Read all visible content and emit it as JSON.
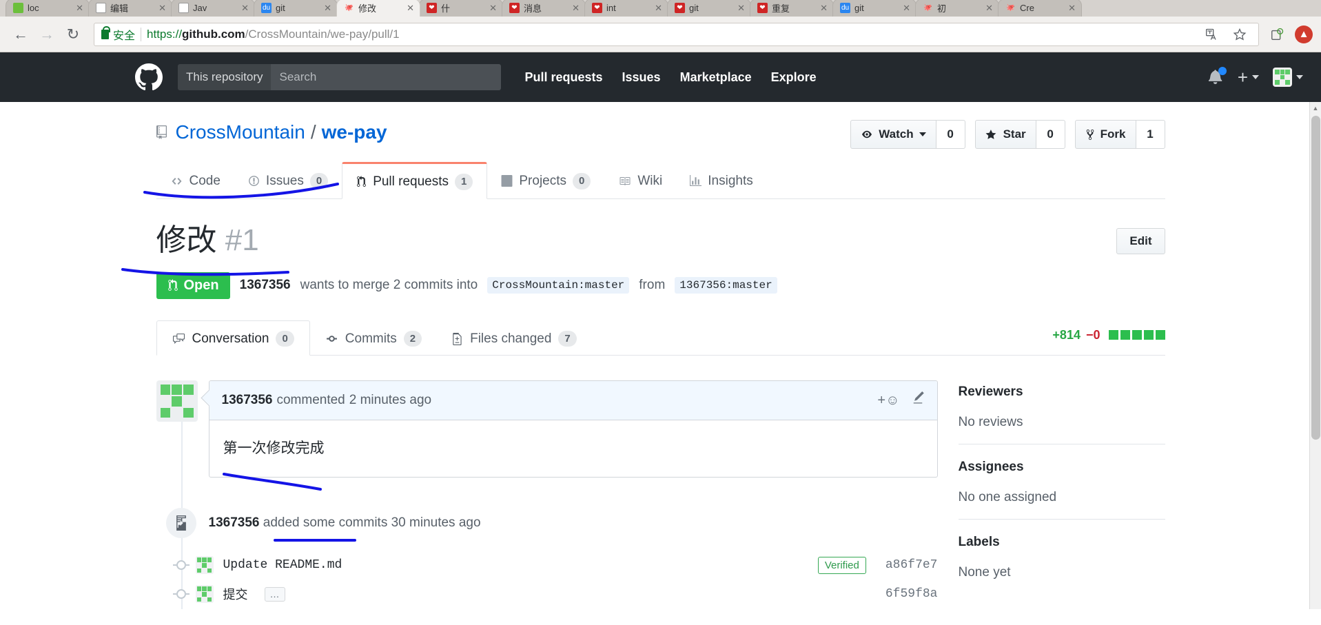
{
  "browser": {
    "tabs": [
      {
        "title": "loc",
        "icon": "leaf-favicon",
        "active": false
      },
      {
        "title": "编辑",
        "icon": "doc-favicon",
        "active": false
      },
      {
        "title": "Jav",
        "icon": "page-favicon",
        "active": false
      },
      {
        "title": "git",
        "icon": "baidu-favicon",
        "active": false
      },
      {
        "title": "修改",
        "icon": "github-favicon",
        "active": true
      },
      {
        "title": "什",
        "icon": "red-favicon",
        "active": false
      },
      {
        "title": "消息",
        "icon": "red-favicon",
        "active": false
      },
      {
        "title": "int",
        "icon": "red-favicon",
        "active": false
      },
      {
        "title": "git",
        "icon": "red-favicon",
        "active": false
      },
      {
        "title": "重复",
        "icon": "red-favicon",
        "active": false
      },
      {
        "title": "git",
        "icon": "baidu-favicon",
        "active": false
      },
      {
        "title": "初",
        "icon": "github-favicon",
        "active": false
      },
      {
        "title": "Cre",
        "icon": "github-favicon",
        "active": false
      }
    ],
    "back_icon": "back-arrow-icon",
    "forward_icon": "forward-arrow-icon",
    "reload_icon": "reload-icon",
    "secure_label": "安全",
    "url": {
      "scheme": "https://",
      "host": "github.com",
      "path": "/CrossMountain/we-pay/pull/1"
    },
    "translate_icon": "translate-icon",
    "bookmark_icon": "star-icon",
    "extension_icon": "extension-icon",
    "profile_icon": "profile-avatar-icon"
  },
  "gh_header": {
    "logo": "github-mark-icon",
    "search_scope": "This repository",
    "search_placeholder": "Search",
    "nav": [
      "Pull requests",
      "Issues",
      "Marketplace",
      "Explore"
    ],
    "notification_icon": "bell-icon",
    "create_new_icon": "plus-icon",
    "account_icon": "user-avatar-icon"
  },
  "repo": {
    "book_icon": "repo-book-icon",
    "owner": "CrossMountain",
    "separator": "/",
    "name": "we-pay",
    "actions": [
      {
        "label": "Watch",
        "count": "0",
        "icon": "eye-icon",
        "has_caret": true
      },
      {
        "label": "Star",
        "count": "0",
        "icon": "star-icon",
        "has_caret": false
      },
      {
        "label": "Fork",
        "count": "1",
        "icon": "fork-icon",
        "has_caret": false
      }
    ],
    "tabs": [
      {
        "label": "Code",
        "count": null,
        "icon": "code-icon",
        "selected": false
      },
      {
        "label": "Issues",
        "count": "0",
        "icon": "issue-opened-icon",
        "selected": false
      },
      {
        "label": "Pull requests",
        "count": "1",
        "icon": "git-pull-request-icon",
        "selected": true
      },
      {
        "label": "Projects",
        "count": "0",
        "icon": "project-board-icon",
        "selected": false
      },
      {
        "label": "Wiki",
        "count": null,
        "icon": "book-icon",
        "selected": false
      },
      {
        "label": "Insights",
        "count": null,
        "icon": "graph-icon",
        "selected": false
      }
    ]
  },
  "pull_request": {
    "title": "修改",
    "number": "#1",
    "edit_label": "Edit",
    "state": "Open",
    "state_icon": "git-pull-request-icon",
    "author": "1367356",
    "merge_text": "wants to merge 2 commits into",
    "base_branch": "CrossMountain:master",
    "from_text": "from",
    "head_branch": "1367356:master",
    "tabs": [
      {
        "label": "Conversation",
        "count": "0",
        "icon": "comment-discussion-icon",
        "selected": true
      },
      {
        "label": "Commits",
        "count": "2",
        "icon": "git-commit-icon",
        "selected": false
      },
      {
        "label": "Files changed",
        "count": "7",
        "icon": "diff-file-icon",
        "selected": false
      }
    ],
    "diffstat": {
      "additions": "+814",
      "deletions": "−0",
      "blocks": 5
    }
  },
  "comment": {
    "author": "1367356",
    "action": "commented",
    "time": "2 minutes ago",
    "body": "第一次修改完成",
    "reaction_icon": "add-reaction-icon",
    "edit_icon": "pencil-icon",
    "avatar_icon": "user-avatar-icon"
  },
  "timeline": {
    "event_icon": "commit-push-icon",
    "event_author": "1367356",
    "event_text": "added some commits",
    "event_time": "30 minutes ago",
    "commits": [
      {
        "message": "Update README.md",
        "badge": "Verified",
        "sha": "a86f7e7",
        "has_ellipsis": false,
        "cjk": false
      },
      {
        "message": "提交",
        "badge": null,
        "sha": "6f59f8a",
        "has_ellipsis": true,
        "ellipsis": "…",
        "cjk": true
      }
    ]
  },
  "sidebar": {
    "sections": [
      {
        "heading": "Reviewers",
        "value": "No reviews"
      },
      {
        "heading": "Assignees",
        "value": "No one assigned"
      },
      {
        "heading": "Labels",
        "value": "None yet"
      }
    ]
  },
  "colors": {
    "accent_green": "#2cbe4e",
    "link_blue": "#0366d6",
    "header_dark": "#24292e",
    "tab_orange": "#f9826c",
    "annotation_blue": "#1414e6"
  }
}
